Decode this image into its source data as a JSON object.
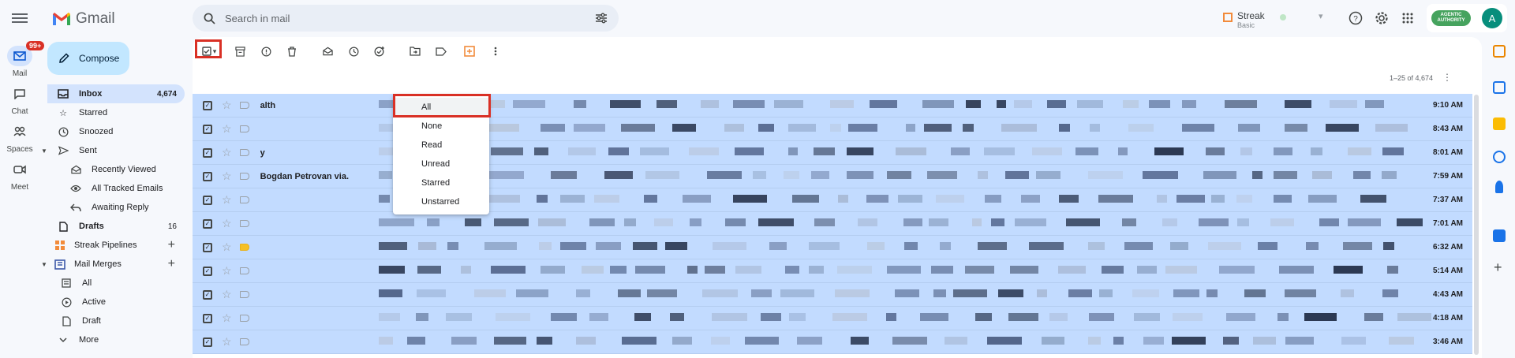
{
  "rail": {
    "items": [
      {
        "label": "Mail",
        "badge": "99+"
      },
      {
        "label": "Chat"
      },
      {
        "label": "Spaces"
      },
      {
        "label": "Meet"
      }
    ]
  },
  "logo": {
    "text": "Gmail"
  },
  "search": {
    "placeholder": "Search in mail"
  },
  "header": {
    "streak_name": "Streak",
    "streak_plan": "Basic",
    "account_badge": "AGENTIC AUTHORITY",
    "avatar_letter": "A"
  },
  "compose": {
    "label": "Compose"
  },
  "nav": {
    "inbox": {
      "label": "Inbox",
      "count": "4,674"
    },
    "starred": "Starred",
    "snoozed": "Snoozed",
    "sent": "Sent",
    "recently_viewed": "Recently Viewed",
    "all_tracked": "All Tracked Emails",
    "awaiting_reply": "Awaiting Reply",
    "drafts": {
      "label": "Drafts",
      "count": "16"
    },
    "streak_pipelines": "Streak Pipelines",
    "mail_merges": "Mail Merges",
    "mm_all": "All",
    "mm_active": "Active",
    "mm_draft": "Draft",
    "more": "More"
  },
  "pager": {
    "text": "1–25 of 4,674"
  },
  "select_menu": {
    "options": [
      "All",
      "None",
      "Read",
      "Unread",
      "Starred",
      "Unstarred"
    ]
  },
  "rows": [
    {
      "sender": "alth",
      "time": "9:10 AM",
      "important": false
    },
    {
      "sender": "",
      "time": "8:43 AM",
      "important": false
    },
    {
      "sender": "y",
      "time": "8:01 AM",
      "important": false
    },
    {
      "sender": "Bogdan Petrovan via.",
      "time": "7:59 AM",
      "important": false
    },
    {
      "sender": "",
      "time": "7:37 AM",
      "important": false
    },
    {
      "sender": "",
      "time": "7:01 AM",
      "important": false
    },
    {
      "sender": "",
      "time": "6:32 AM",
      "important": true
    },
    {
      "sender": "",
      "time": "5:14 AM",
      "important": false
    },
    {
      "sender": "",
      "time": "4:43 AM",
      "important": false
    },
    {
      "sender": "",
      "time": "4:18 AM",
      "important": false
    },
    {
      "sender": "",
      "time": "3:46 AM",
      "important": false
    }
  ],
  "colors": {
    "accent_red": "#d93025",
    "row_selected": "#c2dbff",
    "compose_bg": "#c2e7ff",
    "nav_active": "#d3e3fd"
  }
}
